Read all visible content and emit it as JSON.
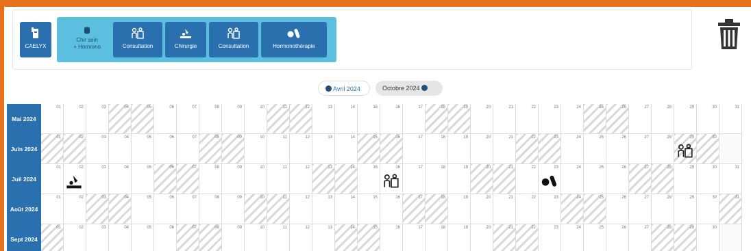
{
  "toolbar": {
    "caelyx_label": "CAELYX",
    "group_label_line1": "Chir sein",
    "group_label_line2": "+ Hormono",
    "buttons": [
      {
        "label": "Consultation",
        "icon": "consultation-icon"
      },
      {
        "label": "Chirurgie",
        "icon": "surgery-icon"
      },
      {
        "label": "Consultation",
        "icon": "consultation-icon"
      },
      {
        "label": "Hormonothérapie",
        "icon": "pills-icon"
      }
    ],
    "delete_icon": "trash-icon"
  },
  "nav": {
    "prev_label": "Avril 2024",
    "next_label": "Octobre 2024"
  },
  "colors": {
    "brand": "#2a6fae",
    "group": "#5bbfe0",
    "frame": "#e8711c"
  },
  "calendar": {
    "months": [
      {
        "label": "Mai 2024"
      },
      {
        "label": "Juin 2024"
      },
      {
        "label": "Juil 2024"
      },
      {
        "label": "Août 2024"
      },
      {
        "label": "Sept 2024"
      }
    ],
    "events": [
      {
        "month": 2,
        "day": 2,
        "type": "surgery-icon"
      },
      {
        "month": 2,
        "day": 16,
        "type": "consultation-icon"
      },
      {
        "month": 2,
        "day": 23,
        "type": "pills-icon"
      },
      {
        "month": 1,
        "day": 29,
        "type": "consultation-icon"
      }
    ]
  }
}
